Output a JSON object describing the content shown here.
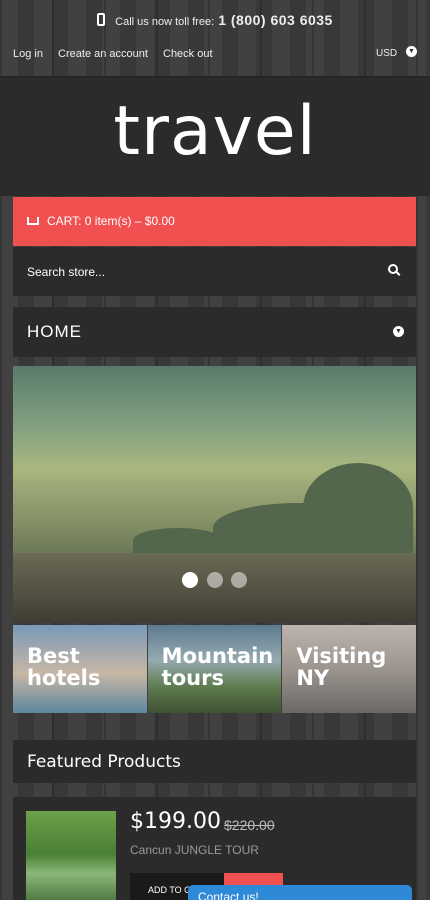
{
  "topbar": {
    "call_text": "Call us now toll free:",
    "phone": "1 (800) 603 6035",
    "links": [
      "Log in",
      "Create an account",
      "Check out"
    ],
    "currency": "USD"
  },
  "logo": "travel",
  "cart": {
    "label": "CART: 0 item(s) – $0.00"
  },
  "search": {
    "placeholder": "Search store..."
  },
  "nav": {
    "label": "HOME"
  },
  "slider": {
    "dots": 3,
    "active_dot": 1
  },
  "tiles": [
    {
      "label": "Best hotels"
    },
    {
      "label": "Mountain tours"
    },
    {
      "label": "Visiting NY"
    }
  ],
  "featured": {
    "title": "Featured Products"
  },
  "product": {
    "price": "$199.00",
    "old_price": "$220.00",
    "name": "Cancun JUNGLE TOUR",
    "add_label": "ADD TO CART"
  },
  "contact": {
    "label": "Contact us!"
  },
  "colors": {
    "accent": "#f05050",
    "panel": "#2b2b2b",
    "contact": "#2e8ad6"
  }
}
